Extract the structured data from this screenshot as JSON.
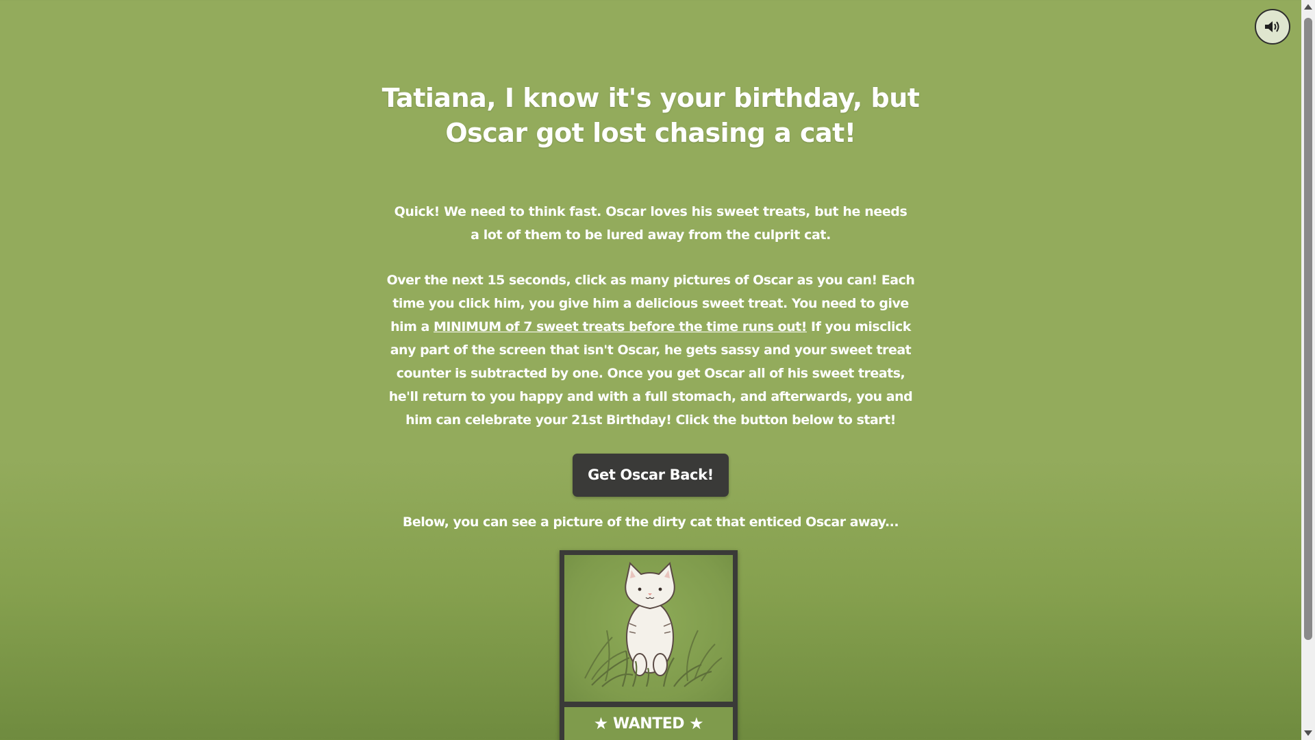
{
  "header": {
    "title": "Tatiana, I know it's your birthday, but Oscar got lost chasing a cat!"
  },
  "main": {
    "intro": "Quick! We need to think fast. Oscar loves his sweet treats, but he needs a lot of them to be lured away from the culprit cat.",
    "instructions_part1": "Over the next 15 seconds, click as many pictures of Oscar as you can! Each time you click him, you give him a delicious sweet treat. You need to give him a ",
    "instructions_underlined": "MINIMUM of 7 sweet treats before the time runs out!",
    "instructions_part2": " If you misclick any part of the screen that isn't Oscar, he gets sassy and your sweet treat counter is subtracted by one. Once you get Oscar all of his sweet treats, he'll return to you happy and with a full stomach, and afterwards, you and him can celebrate your 21st Birthday! Click the button below to start!",
    "start_button_label": "Get Oscar Back!",
    "below_text": "Below, you can see a picture of the dirty cat that enticed Oscar away..."
  },
  "poster": {
    "caption": "WANTED",
    "star_icon": "★",
    "image_subject": "white cat sitting in grass"
  },
  "controls": {
    "sound_icon": "volume-icon"
  },
  "colors": {
    "background": "#93ab5c",
    "button": "#3a3a38",
    "text": "#ffffff",
    "poster_frame": "#3a3a38"
  }
}
